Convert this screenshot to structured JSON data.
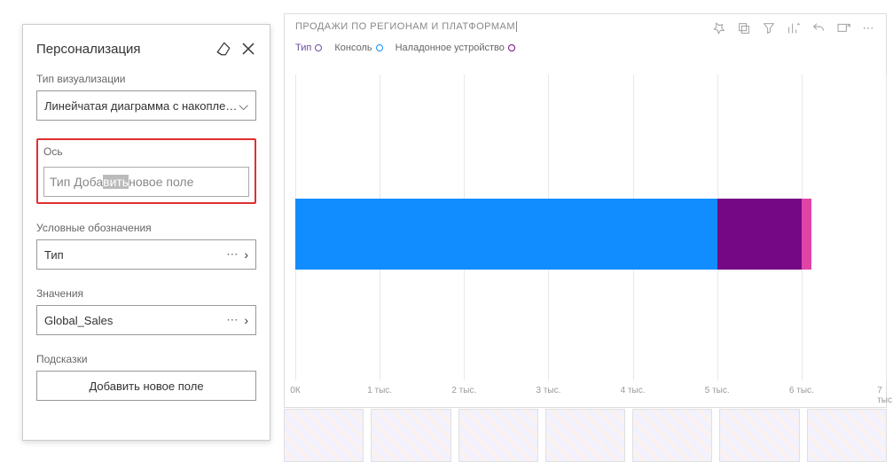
{
  "panel": {
    "title": "Персонализация",
    "viz_type_label": "Тип визуализации",
    "viz_type_value": "Линейчатая диаграмма с накоплением",
    "axis_label": "Ось",
    "axis_text_pre": "Тип Доба",
    "axis_text_hl": "вить",
    "axis_text_rest": " новое поле",
    "legend_label": "Условные обозначения",
    "legend_value": "Тип",
    "values_label": "Значения",
    "values_value": "Global_Sales",
    "tooltips_label": "Подсказки",
    "add_field_btn": "Добавить новое поле"
  },
  "viz": {
    "title": "ПРОДАЖИ ПО РЕГИОНАМ И ПЛАТФОРМАМ",
    "legend_axis": "Тип",
    "legend_items": [
      {
        "label": "Консоль",
        "color": "#118DFF"
      },
      {
        "label": "Наладонное устройство",
        "color": "#750985"
      }
    ]
  },
  "chart_data": {
    "type": "bar",
    "orientation": "horizontal",
    "stacked": true,
    "categories": [
      ""
    ],
    "series": [
      {
        "name": "Консоль",
        "values": [
          5000
        ],
        "color": "#118DFF"
      },
      {
        "name": "Наладонное устройство",
        "values": [
          1000
        ],
        "color": "#750985"
      },
      {
        "name": "",
        "values": [
          120
        ],
        "color": "#E044A7"
      }
    ],
    "xlim": [
      0,
      7000
    ],
    "xticks": [
      0,
      1000,
      2000,
      3000,
      4000,
      5000,
      6000,
      7000
    ],
    "xtick_labels": [
      "0К",
      "1 тыс.",
      "2 тыс.",
      "3 тыс.",
      "4 тыс.",
      "5 тыс.",
      "6 тыс.",
      "7 тыс."
    ],
    "title": "ПРОДАЖИ ПО РЕГИОНАМ И ПЛАТФОРМАМ",
    "xlabel": "",
    "ylabel": ""
  }
}
